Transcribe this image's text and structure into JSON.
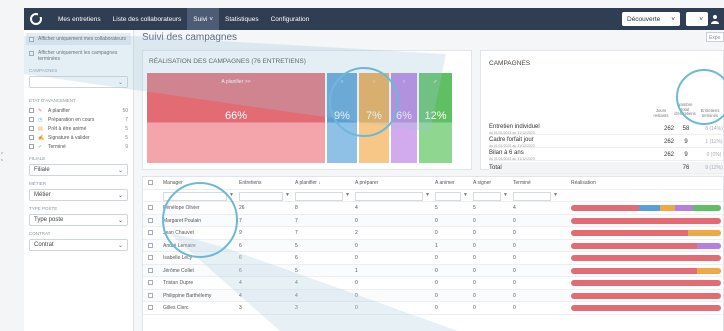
{
  "left_strip": {
    "label_a": "z",
    "label_b": "s"
  },
  "nav": {
    "items": [
      "Mes entretiens",
      "Liste des collaborateurs",
      "Suivi",
      "Statistiques",
      "Configuration"
    ],
    "active_index": 2,
    "suivi_chevron": "˅",
    "mode_select": "Découverte",
    "mode_chevron": "˅",
    "extra_chevron": "˅"
  },
  "sidebar": {
    "opt1": "Afficher uniquement mes collaborateurs",
    "opt2": "Afficher uniquement les campagnes terminées",
    "campagnes_label": "CAMPAGNES",
    "campagnes_value": "",
    "avancement_label": "ÉTAT D'AVANCEMENT",
    "avancement": [
      {
        "label": "A planifier",
        "count": "50"
      },
      {
        "label": "Préparation en cours",
        "count": "7"
      },
      {
        "label": "Prêt à être animé",
        "count": "5"
      },
      {
        "label": "Signature à valider",
        "count": "5"
      },
      {
        "label": "Terminé",
        "count": "9"
      }
    ],
    "filiale_label": "FILIALE",
    "filiale_value": "Filiale",
    "metier_label": "MÉTIER",
    "metier_value": "Métier",
    "poste_label": "TYPE POSTE",
    "poste_value": "Type poste",
    "contrat_label": "CONTRAT",
    "contrat_value": "Contrat"
  },
  "main": {
    "title": "Suivi des campagnes",
    "export_label": "Expo"
  },
  "realisation": {
    "title": "RÉALISATION DES CAMPAGNES (76 ENTRETIENS)",
    "segments": [
      {
        "pct": 66,
        "label": "66%",
        "top": "A planifier >>",
        "color": "#e36b74",
        "shade": "#f3a5ab"
      },
      {
        "pct": 9,
        "label": "9%",
        "top": "○",
        "color": "#5a9fd6",
        "shade": "#8fc0e6"
      },
      {
        "pct": 7,
        "label": "7%",
        "top": "○",
        "color": "#f0a746",
        "shade": "#f6c787"
      },
      {
        "pct": 6,
        "label": "6%",
        "top": "○",
        "color": "#b77ee0",
        "shade": "#d2aaee"
      },
      {
        "pct": 12,
        "label": "12%",
        "top": "✓",
        "color": "#5fbf62",
        "shade": "#8fd691"
      }
    ]
  },
  "campagnes": {
    "title": "CAMPAGNES",
    "col1": "Jours restants",
    "col2": "Nombre total d'entretiens",
    "col3": "Entretiens terminés",
    "rows": [
      {
        "name": "Entretien individuel",
        "dates": "du 01/01/2023 au 31/12/2023",
        "v1": "262",
        "v2": "58",
        "v3": "8 (14%)"
      },
      {
        "name": "Cadre forfait jour",
        "dates": "du 01/01/2023 au 31/12/2023",
        "v1": "262",
        "v2": "9",
        "v3": "1 (11%)"
      },
      {
        "name": "Bilan à 6 ans",
        "dates": "du 01/01/2023 au 31/12/2023",
        "v1": "262",
        "v2": "9",
        "v3": "0 (0%)"
      }
    ],
    "total": {
      "name": "Total",
      "v2": "76",
      "v3": "9 (12%)"
    }
  },
  "table": {
    "headers": [
      "Manager",
      "Entretiens",
      "A planifier",
      "A préparer",
      "A animer",
      "A signer",
      "Terminé",
      "Réalisation"
    ],
    "sort_indicator": "↓",
    "filter_icon": "▼",
    "rows": [
      {
        "manager": "Pénélope Olivier",
        "vals": [
          "26",
          "8",
          "4",
          "5",
          "5",
          "4"
        ],
        "prog": [
          45,
          14,
          10,
          12,
          19
        ]
      },
      {
        "manager": "Margaret Poulain",
        "vals": [
          "7",
          "7",
          "0",
          "0",
          "0",
          "0"
        ],
        "prog": [
          100,
          0,
          0,
          0,
          0
        ]
      },
      {
        "manager": "Jean Chauvet",
        "vals": [
          "9",
          "7",
          "2",
          "0",
          "0",
          "0"
        ],
        "prog": [
          78,
          0,
          22,
          0,
          0
        ]
      },
      {
        "manager": "André Lemaire",
        "vals": [
          "6",
          "5",
          "0",
          "1",
          "0",
          "0"
        ],
        "prog": [
          84,
          0,
          0,
          16,
          0
        ]
      },
      {
        "manager": "Isabelle Lecy",
        "vals": [
          "6",
          "6",
          "0",
          "0",
          "0",
          "0"
        ],
        "prog": [
          100,
          0,
          0,
          0,
          0
        ]
      },
      {
        "manager": "Jérôme Collet",
        "vals": [
          "6",
          "5",
          "1",
          "0",
          "0",
          "0"
        ],
        "prog": [
          84,
          0,
          16,
          0,
          0
        ]
      },
      {
        "manager": "Tristan Dupre",
        "vals": [
          "4",
          "4",
          "0",
          "0",
          "0",
          "0"
        ],
        "prog": [
          100,
          0,
          0,
          0,
          0
        ]
      },
      {
        "manager": "Philippine Barthélemy",
        "vals": [
          "4",
          "4",
          "0",
          "0",
          "0",
          "0"
        ],
        "prog": [
          100,
          0,
          0,
          0,
          0
        ]
      },
      {
        "manager": "Gilles Clerc",
        "vals": [
          "3",
          "3",
          "0",
          "0",
          "0",
          "0"
        ],
        "prog": [
          100,
          0,
          0,
          0,
          0
        ]
      }
    ]
  },
  "colors": {
    "nav_bg": "#2f3e52",
    "planifier": "#e36b74",
    "preparer": "#5a9fd6",
    "animer": "#f0a746",
    "signer": "#b77ee0",
    "termine": "#5fbf62",
    "highlight": "#6cb8d8"
  }
}
